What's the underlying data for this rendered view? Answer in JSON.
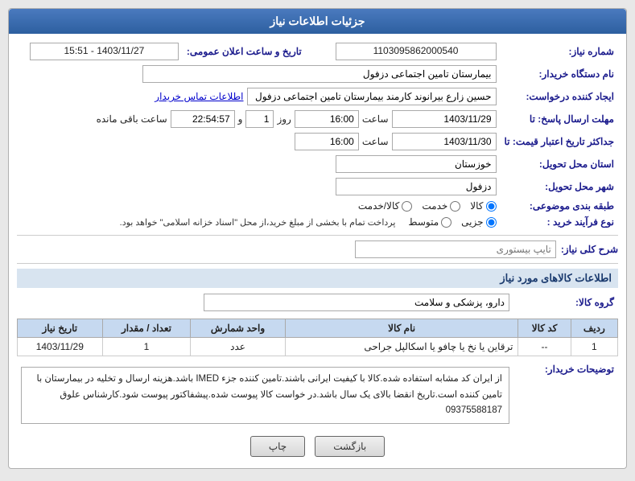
{
  "header": {
    "title": "جزئیات اطلاعات نیاز"
  },
  "fields": {
    "shomara_niaz_label": "شماره نیاز:",
    "shomara_niaz_value": "1103095862000540",
    "nam_dastgah_label": "نام دستگاه خریدار:",
    "nam_dastgah_value": "بیمارستان تامین اجتماعی دزفول",
    "ijad_konande_label": "ایجاد کننده درخواست:",
    "ijad_konande_value": "حسین زارع بیرانوند کارمند بیمارستان تامین اجتماعی دزفول",
    "ettelaat_tamas_link": "اطلاعات تماس خریدار",
    "mohlat_ersal_label": "مهلت ارسال پاسخ: تا",
    "date1": "1403/11/29",
    "time1": "16:00",
    "rooz": "1",
    "saaat": "22:54:57",
    "saaat_baqi_mande": "ساعت باقی مانده",
    "jadval_label": "جداکثر تاریخ اعتبار قیمت: تا",
    "date2": "1403/11/30",
    "time2": "16:00",
    "ostan_tahvil_label": "استان محل تحویل:",
    "ostan_tahvil_value": "خوزستان",
    "shahr_tahvil_label": "شهر محل تحویل:",
    "shahr_tahvil_value": "دزفول",
    "tabaqa_label": "طبقه بندی موضوعی:",
    "tabaqa_options": [
      "کالا",
      "خدمت",
      "کالا/خدمت"
    ],
    "tabaqa_selected": "کالا",
    "nooe_farayand_label": "نوع فرآیند خرید :",
    "nooe_options": [
      "جزیی",
      "متوسط"
    ],
    "nooe_note": "پرداخت تمام با بخشی از مبلغ خرید،از محل \"اسناد خزانه اسلامی\" خواهد بود.",
    "nooe_selected": "جزیی",
    "date_header": "تاریخ و ساعت اعلان عمومی:",
    "date_header_value": "1403/11/27 - 15:51",
    "sharh_label": "شرح کلی نیاز:",
    "type_search_placeholder": "تایپ بیستوری",
    "ettelaat_section": "اطلاعات کالاهای مورد نیاز",
    "group_kala_label": "گروه کالا:",
    "group_kala_value": "دارو، پزشکی و سلامت",
    "table": {
      "headers": [
        "ردیف",
        "کد کالا",
        "نام کالا",
        "واحد شمارش",
        "تعداد / مقدار",
        "تاریخ نیاز"
      ],
      "rows": [
        {
          "radif": "1",
          "kod_kala": "--",
          "nam_kala": "ترقاین یا نخ یا چافو یا اسکالپل جراحی",
          "vahed": "عدد",
          "tedad": "1",
          "tarikh": "1403/11/29"
        }
      ]
    },
    "tozi_header": "توضیحات خریدار:",
    "tozi_text": "از ایران کد مشابه استفاده شده.کالا با کیفیت ایرانی باشند.تامین کننده جزء IMED باشد.هزینه ارسال و تخلیه در بیمارستان با تامین کننده است.تاریخ انقضا بالای یک سال باشد.در خواست کالا پیوست شده.پیشفاکتور پیوست شود.کارشناس علوق 09375588187"
  },
  "buttons": {
    "back_label": "بازگشت",
    "print_label": "چاپ"
  }
}
